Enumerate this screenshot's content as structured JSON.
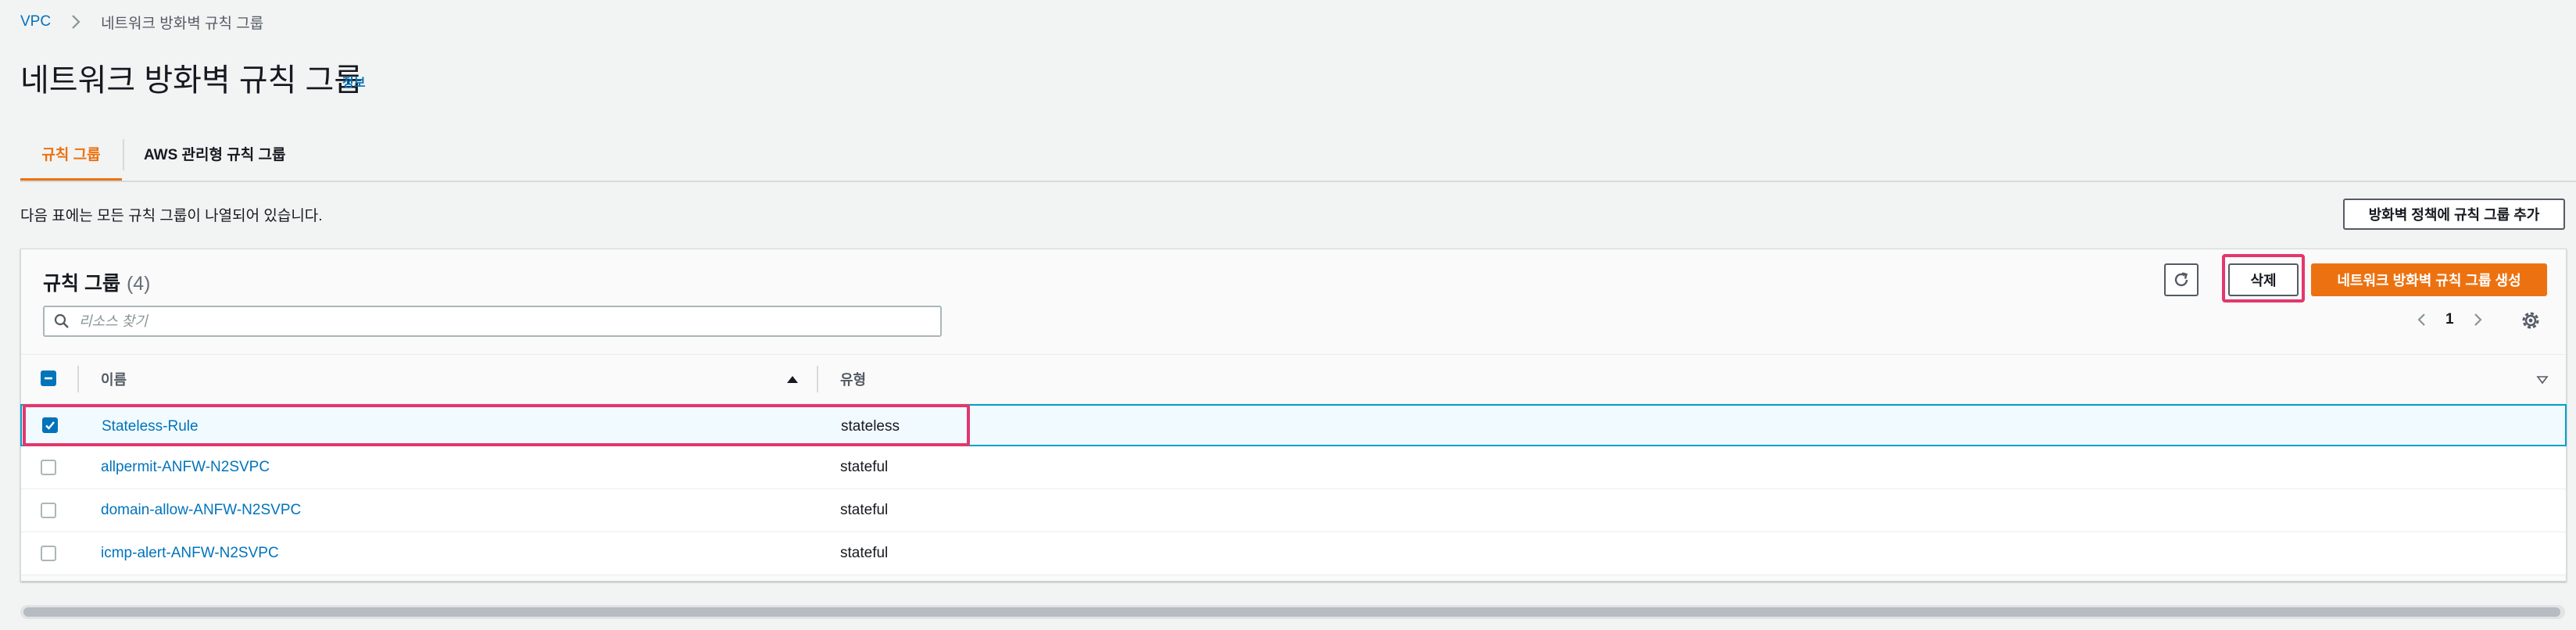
{
  "breadcrumb": {
    "root": "VPC",
    "current": "네트워크 방화벽 규칙 그룹"
  },
  "header": {
    "title": "네트워크 방화벽 규칙 그룹",
    "info": "정보"
  },
  "tabs": [
    {
      "label": "규칙 그룹",
      "active": true
    },
    {
      "label": "AWS 관리형 규칙 그룹",
      "active": false
    }
  ],
  "description": "다음 표에는 모든 규칙 그룹이 나열되어 있습니다.",
  "add_to_policy_button": "방화벽 정책에 규칙 그룹 추가",
  "panel": {
    "title": "규칙 그룹",
    "count": "(4)",
    "delete_button": "삭제",
    "create_button": "네트워크 방화벽 규칙 그룹 생성",
    "search_placeholder": "리소스 찾기",
    "page": "1"
  },
  "table": {
    "columns": [
      "이름",
      "유형"
    ],
    "rows": [
      {
        "name": "Stateless-Rule",
        "type": "stateless",
        "selected": true
      },
      {
        "name": "allpermit-ANFW-N2SVPC",
        "type": "stateful",
        "selected": false
      },
      {
        "name": "domain-allow-ANFW-N2SVPC",
        "type": "stateful",
        "selected": false
      },
      {
        "name": "icmp-alert-ANFW-N2SVPC",
        "type": "stateful",
        "selected": false
      }
    ]
  },
  "colors": {
    "accent": "#ec7211",
    "link": "#0073bb",
    "highlight": "#e3376d",
    "selected_row": "#f1faff"
  },
  "icons": [
    "chevron-right-icon",
    "refresh-icon",
    "search-icon",
    "chevron-left-icon",
    "settings-gear-icon",
    "sort-up-icon",
    "sort-down-icon",
    "check-icon",
    "indeterminate-icon"
  ]
}
